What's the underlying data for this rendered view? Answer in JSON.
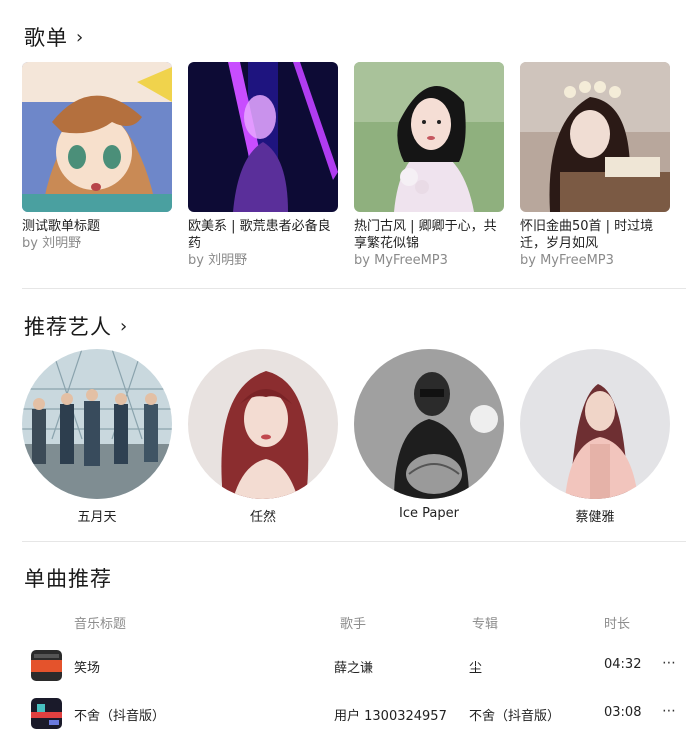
{
  "playlists": {
    "title": "歌单",
    "items": [
      {
        "title": "测试歌单标题",
        "author": "by 刘明野"
      },
      {
        "title": "欧美系 | 歌荒患者必备良药",
        "author": "by 刘明野"
      },
      {
        "title": "热门古风 | 卿卿于心，共享繁花似锦",
        "author": "by MyFreeMP3"
      },
      {
        "title": "怀旧金曲50首 | 时过境迁，岁月如风",
        "author": "by MyFreeMP3"
      }
    ]
  },
  "artists": {
    "title": "推荐艺人",
    "items": [
      {
        "name": "五月天"
      },
      {
        "name": "任然"
      },
      {
        "name": "Ice Paper"
      },
      {
        "name": "蔡健雅"
      }
    ]
  },
  "songs": {
    "title": "单曲推荐",
    "headers": {
      "title": "音乐标题",
      "artist": "歌手",
      "album": "专辑",
      "duration": "时长"
    },
    "rows": [
      {
        "title": "笑场",
        "artist": "薛之谦",
        "album": "尘",
        "duration": "04:32"
      },
      {
        "title": "不舍（抖音版）",
        "artist": "用户 1300324957",
        "album": "不舍（抖音版）",
        "duration": "03:08"
      }
    ]
  },
  "icons": {
    "chevron": "chevron-right-icon",
    "more": "more-horizontal-icon"
  }
}
